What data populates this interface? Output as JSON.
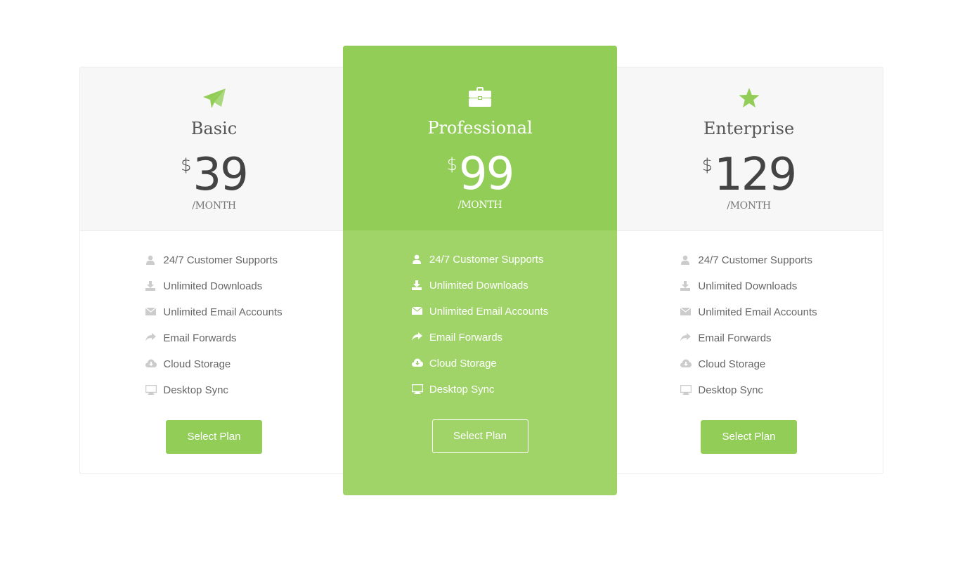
{
  "colors": {
    "accent": "#92cd58",
    "accent_light": "#a0d468",
    "panel": "#f7f7f7",
    "icon_muted": "#cccccc"
  },
  "plans": [
    {
      "name": "Basic",
      "icon": "paper-plane-icon",
      "currency": "$",
      "price": "39",
      "period": "/MONTH",
      "features": [
        "24/7 Customer Supports",
        "Unlimited Downloads",
        "Unlimited Email Accounts",
        "Email Forwards",
        "Cloud Storage",
        "Desktop Sync"
      ],
      "button_label": "Select Plan"
    },
    {
      "name": "Professional",
      "icon": "briefcase-icon",
      "currency": "$",
      "price": "99",
      "period": "/MONTH",
      "features": [
        "24/7 Customer Supports",
        "Unlimited Downloads",
        "Unlimited Email Accounts",
        "Email Forwards",
        "Cloud Storage",
        "Desktop Sync"
      ],
      "button_label": "Select Plan"
    },
    {
      "name": "Enterprise",
      "icon": "star-icon",
      "currency": "$",
      "price": "129",
      "period": "/MONTH",
      "features": [
        "24/7 Customer Supports",
        "Unlimited Downloads",
        "Unlimited Email Accounts",
        "Email Forwards",
        "Cloud Storage",
        "Desktop Sync"
      ],
      "button_label": "Select Plan"
    }
  ],
  "feature_icons": [
    "user-icon",
    "download-icon",
    "envelope-icon",
    "share-icon",
    "cloud-download-icon",
    "desktop-icon"
  ]
}
